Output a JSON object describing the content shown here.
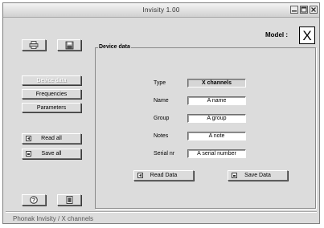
{
  "window": {
    "title": "Invisity 1.00"
  },
  "header": {
    "model_label": "Model :",
    "model_value": "X"
  },
  "sidebar": {
    "top_icons": [
      {
        "icon": "printer-icon"
      },
      {
        "icon": "floppy-disk-icon"
      }
    ],
    "nav": [
      {
        "label": "Device data",
        "enabled": false
      },
      {
        "label": "Frequencies",
        "enabled": true
      },
      {
        "label": "Parameters",
        "enabled": true
      }
    ],
    "actions": [
      {
        "label": "Read all",
        "icon": "read-icon"
      },
      {
        "label": "Save all",
        "icon": "save-icon"
      }
    ],
    "bottom_icons": [
      {
        "icon": "help-icon"
      },
      {
        "icon": "exit-door-icon"
      }
    ]
  },
  "device_data": {
    "group_label": "Device data",
    "fields": [
      {
        "label": "Type",
        "value": "X channels"
      },
      {
        "label": "Name",
        "value": "A name"
      },
      {
        "label": "Group",
        "value": "A group"
      },
      {
        "label": "Notes",
        "value": "A note"
      },
      {
        "label": "Serial nr",
        "value": "A serial number"
      }
    ],
    "read_button": "Read Data",
    "save_button": "Save Data"
  },
  "status_bar": {
    "text": "Phonak Invisity  /  X channels"
  }
}
